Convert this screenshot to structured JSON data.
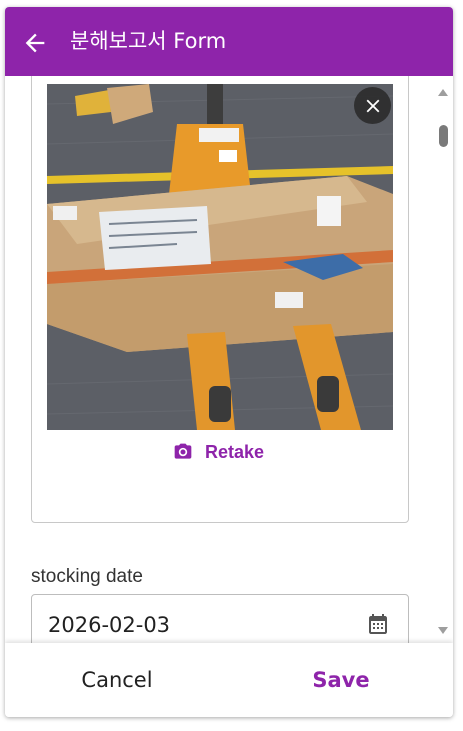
{
  "header": {
    "title": "분해보고서 Form",
    "back_icon": "arrow-left-icon"
  },
  "photo": {
    "close_icon": "close-icon",
    "retake_label": "Retake",
    "retake_icon": "camera-icon"
  },
  "stocking_date": {
    "label": "stocking date",
    "value": "2026-02-03",
    "icon": "calendar-icon"
  },
  "footer": {
    "cancel_label": "Cancel",
    "save_label": "Save"
  },
  "colors": {
    "primary": "#8e24aa"
  }
}
